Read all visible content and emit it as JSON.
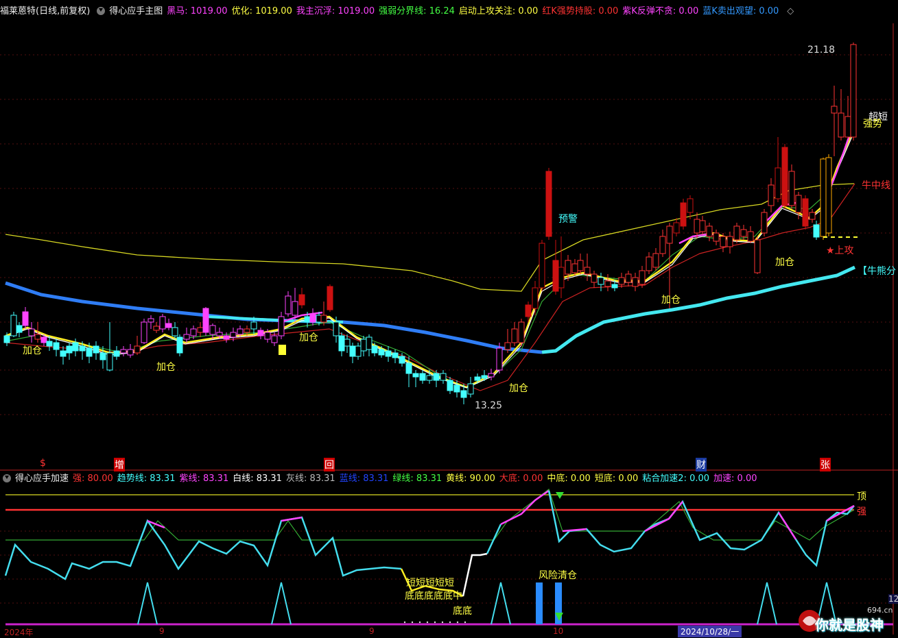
{
  "header": {
    "stock": "福莱蒽特(日线,前复权)",
    "indicator": "得心应手主图",
    "items": [
      {
        "label": "黑马:",
        "value": "1019.00",
        "color": "#ff44ff"
      },
      {
        "label": "优化:",
        "value": "1019.00",
        "color": "#ffff44"
      },
      {
        "label": "我主沉浮:",
        "value": "1019.00",
        "color": "#ff44ff"
      },
      {
        "label": "强弱分界线:",
        "value": "16.24",
        "color": "#44ff44"
      },
      {
        "label": "启动上攻关注:",
        "value": "0.00",
        "color": "#ffff44"
      },
      {
        "label": "红K强势持股:",
        "value": "0.00",
        "color": "#ff3333"
      },
      {
        "label": "紫K反弹不贪:",
        "value": "0.00",
        "color": "#ff44ff"
      },
      {
        "label": "蓝K卖出观望:",
        "value": "0.00",
        "color": "#3399ff"
      }
    ],
    "diamond": "◇"
  },
  "sub_header": {
    "indicator": "得心应手加速",
    "items": [
      {
        "label": "强:",
        "value": "80.00",
        "color": "#ff3333"
      },
      {
        "label": "趋势线:",
        "value": "83.31",
        "color": "#44ffff"
      },
      {
        "label": "紫线:",
        "value": "83.31",
        "color": "#ff44ff"
      },
      {
        "label": "白线:",
        "value": "83.31",
        "color": "#ffffff"
      },
      {
        "label": "灰线:",
        "value": "83.31",
        "color": "#bbbbbb"
      },
      {
        "label": "蓝线:",
        "value": "83.31",
        "color": "#2244ff"
      },
      {
        "label": "绿线:",
        "value": "83.31",
        "color": "#44ff44"
      },
      {
        "label": "黄线:",
        "value": "90.00",
        "color": "#ffff44"
      },
      {
        "label": "大底:",
        "value": "0.00",
        "color": "#ff3333"
      },
      {
        "label": "中底:",
        "value": "0.00",
        "color": "#ffff44"
      },
      {
        "label": "短底:",
        "value": "0.00",
        "color": "#ffff44"
      },
      {
        "label": "粘合加速2:",
        "value": "0.00",
        "color": "#44ffff"
      },
      {
        "label": "加速:",
        "value": "0.00",
        "color": "#ff44ff"
      }
    ]
  },
  "annotations": {
    "high": "21.18",
    "low": "13.25",
    "add": "加仓",
    "warn": "预警",
    "top_dup": "超短",
    "strong": "强势",
    "bull_mid": "牛中线",
    "attack": "★上攻",
    "bull_bear": "【牛熊分",
    "risk": "风险清仓",
    "bottoms": "底底底底底中",
    "bottom": "底底",
    "short_repeat": "短短短短短",
    "top_label": "顶",
    "strong_label": "强"
  },
  "event_markers": [
    {
      "label": "$",
      "color": "#ff3333"
    },
    {
      "label": "增",
      "color": "#ffffff"
    },
    {
      "label": "回",
      "color": "#ffffff"
    },
    {
      "label": "财",
      "color": "#ffffff"
    },
    {
      "label": "张",
      "color": "#ffffff"
    }
  ],
  "axis_dates": [
    "2024年",
    "9",
    "9",
    "10",
    "2024/10/28/一"
  ],
  "watermark": {
    "site": "694.cn",
    "title": "你就是股神"
  },
  "right_edge": "12"
}
